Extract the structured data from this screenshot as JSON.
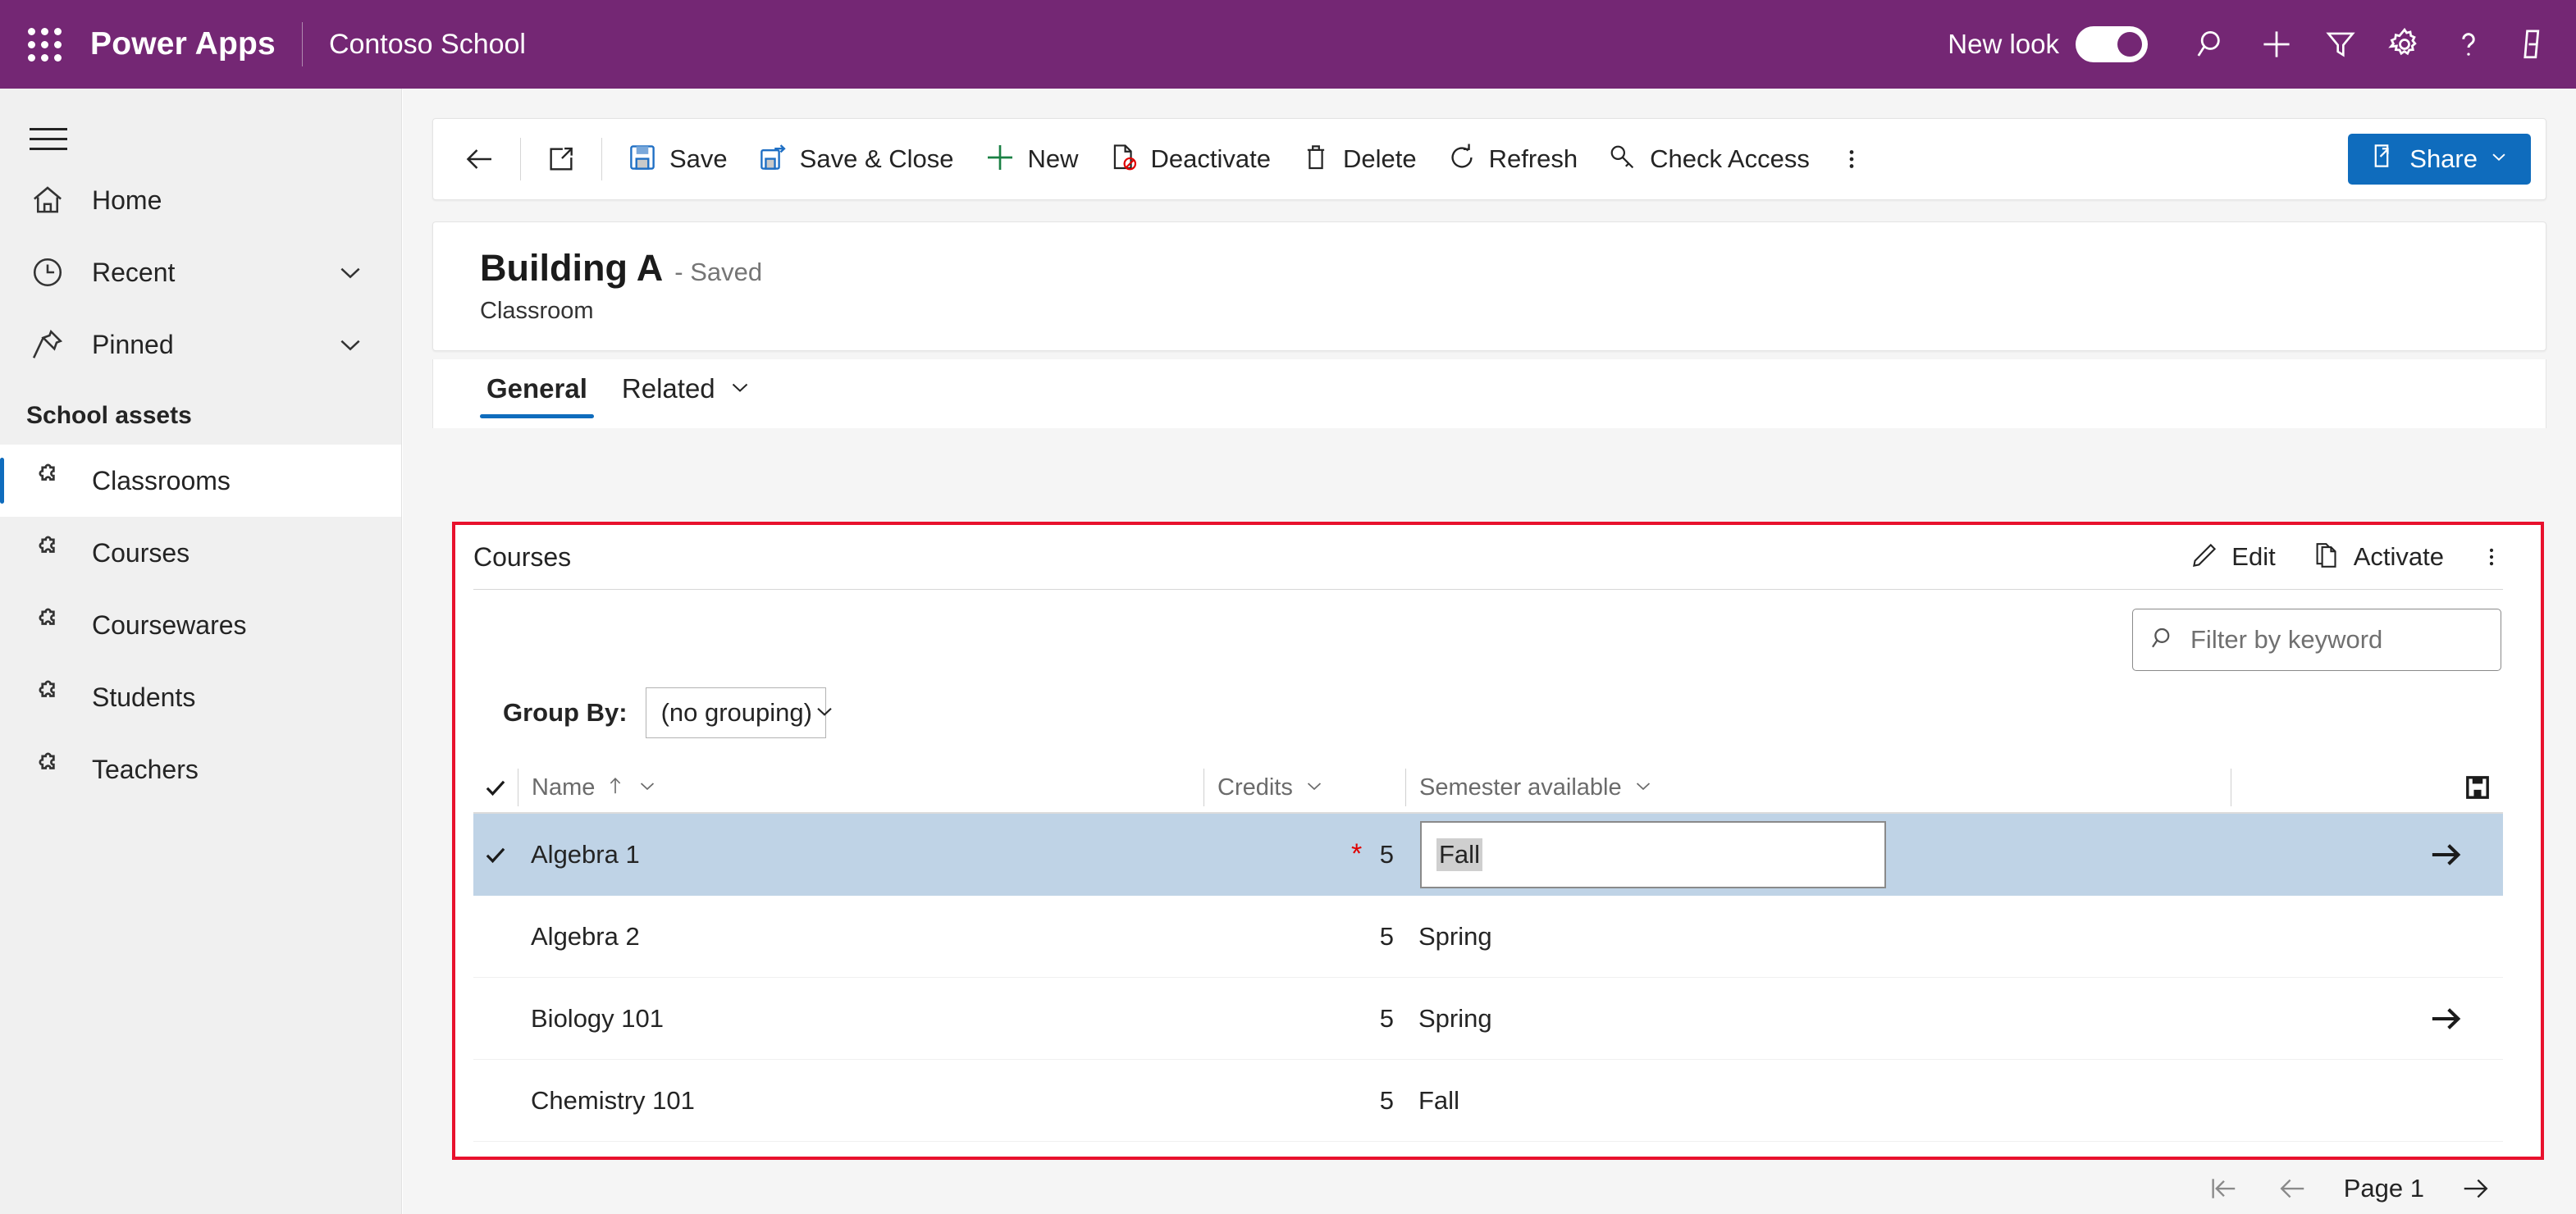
{
  "header": {
    "waffle_icon": "app-launcher-icon",
    "brand": "Power Apps",
    "environment": "Contoso School",
    "new_look_label": "New look",
    "new_look_on": true,
    "icons": [
      "search-icon",
      "plus-icon",
      "filter-icon",
      "gear-icon",
      "help-icon",
      "feedback-icon"
    ],
    "brand_color": "#742774"
  },
  "sidebar": {
    "menu_icon": "hamburger-icon",
    "items": [
      {
        "label": "Home",
        "icon": "home-icon",
        "expandable": false,
        "active": false
      },
      {
        "label": "Recent",
        "icon": "clock-icon",
        "expandable": true,
        "active": false
      },
      {
        "label": "Pinned",
        "icon": "pin-icon",
        "expandable": true,
        "active": false
      }
    ],
    "group_title": "School assets",
    "entities": [
      {
        "label": "Classrooms",
        "icon": "puzzle-icon",
        "active": true
      },
      {
        "label": "Courses",
        "icon": "puzzle-icon",
        "active": false
      },
      {
        "label": "Coursewares",
        "icon": "puzzle-icon",
        "active": false
      },
      {
        "label": "Students",
        "icon": "puzzle-icon",
        "active": false
      },
      {
        "label": "Teachers",
        "icon": "puzzle-icon",
        "active": false
      }
    ]
  },
  "commandbar": {
    "back_icon": "back-arrow-icon",
    "popout_icon": "open-in-new-window-icon",
    "buttons": [
      {
        "label": "Save",
        "icon": "save-icon"
      },
      {
        "label": "Save & Close",
        "icon": "save-and-close-icon"
      },
      {
        "label": "New",
        "icon": "plus-icon"
      },
      {
        "label": "Deactivate",
        "icon": "deactivate-icon"
      },
      {
        "label": "Delete",
        "icon": "trash-icon"
      },
      {
        "label": "Refresh",
        "icon": "refresh-icon"
      },
      {
        "label": "Check Access",
        "icon": "key-icon"
      }
    ],
    "overflow_icon": "more-vertical-icon",
    "share": {
      "label": "Share",
      "icon": "share-icon",
      "chevron": "chevron-down-icon",
      "color": "#0f6cbd"
    }
  },
  "record": {
    "name": "Building A",
    "status": "- Saved",
    "entity": "Classroom"
  },
  "tabs": [
    {
      "label": "General",
      "selected": true,
      "chevron": false
    },
    {
      "label": "Related",
      "selected": false,
      "chevron": true
    }
  ],
  "grid": {
    "title": "Courses",
    "actions": [
      {
        "label": "Edit",
        "icon": "pencil-icon"
      },
      {
        "label": "Activate",
        "icon": "document-copy-icon"
      }
    ],
    "overflow_icon": "more-vertical-icon",
    "filter": {
      "placeholder": "Filter by keyword",
      "value": "",
      "icon": "search-icon"
    },
    "group_by": {
      "label": "Group By:",
      "value": "(no grouping)",
      "chevron": "chevron-down-icon"
    },
    "highlight_color": "#e8112d",
    "select_all_icon": "checkmark-icon",
    "save_icon": "save-icon",
    "columns": [
      {
        "label": "Name",
        "sort": "ascending-arrow-icon",
        "chevron": "chevron-down-icon"
      },
      {
        "label": "Credits",
        "sort": "",
        "chevron": "chevron-down-icon"
      },
      {
        "label": "Semester available",
        "sort": "",
        "chevron": "chevron-down-icon"
      }
    ],
    "rows": [
      {
        "name": "Algebra 1",
        "credits": "5",
        "semester": "Fall",
        "selected": true,
        "checked": true,
        "required_marker": "*",
        "editing": true,
        "arrow": "arrow-right-icon"
      },
      {
        "name": "Algebra 2",
        "credits": "5",
        "semester": "Spring",
        "selected": false,
        "checked": false,
        "required_marker": "",
        "editing": false,
        "arrow": ""
      },
      {
        "name": "Biology 101",
        "credits": "5",
        "semester": "Spring",
        "selected": false,
        "checked": false,
        "required_marker": "",
        "editing": false,
        "arrow": "arrow-right-icon"
      },
      {
        "name": "Chemistry 101",
        "credits": "5",
        "semester": "Fall",
        "selected": false,
        "checked": false,
        "required_marker": "",
        "editing": false,
        "arrow": ""
      }
    ],
    "pager": {
      "first_icon": "page-first-icon",
      "prev_icon": "page-prev-icon",
      "label": "Page 1",
      "next_icon": "page-next-icon"
    }
  }
}
